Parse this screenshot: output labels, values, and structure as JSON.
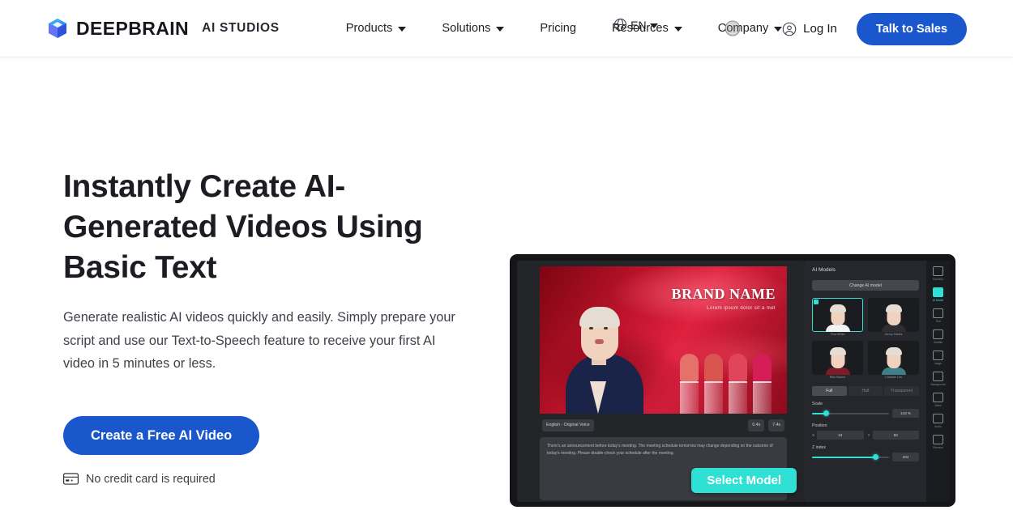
{
  "header": {
    "brand": {
      "name": "DEEPBRAIN",
      "sub": "AI STUDIOS",
      "logo_icon": "cube-logo-icon"
    },
    "nav": [
      {
        "label": "Products",
        "has_chevron": true
      },
      {
        "label": "Solutions",
        "has_chevron": true
      },
      {
        "label": "Pricing",
        "has_chevron": false
      },
      {
        "label": "Resources",
        "has_chevron": true
      },
      {
        "label": "Company",
        "has_chevron": true
      }
    ],
    "language": {
      "label": "EN",
      "icon": "globe-icon"
    },
    "login": {
      "label": "Log In",
      "icon": "user-circle-icon"
    },
    "cta": {
      "label": "Talk to Sales",
      "color": "#1a56cc"
    }
  },
  "hero": {
    "title": "Instantly Create AI-Generated Videos Using Basic Text",
    "subtitle": "Generate realistic AI videos quickly and easily. Simply prepare your script and use our Text-to-Speech feature to receive your first AI video in 5 minutes or less.",
    "cta": {
      "label": "Create a Free AI Video",
      "color": "#1a56cc"
    },
    "note": {
      "label": "No credit card is required",
      "icon": "credit-card-icon"
    }
  },
  "demo": {
    "stage": {
      "brand_title": "BRAND NAME",
      "brand_tagline": "Lorem ipsum dolor sit a met"
    },
    "toolbar": {
      "voice": "English - Original Voice",
      "duration": "0.4s",
      "total": "7.4s"
    },
    "script": "There's an announcement before today's meeting. The meeting schedule tomorrow may change depending on the outcome of today's meeting. Please double-check your schedule after the meeting.",
    "select_model_button": "Select Model",
    "inspector": {
      "title": "AI Models",
      "change_button": "Change AI model",
      "models": [
        {
          "name": "Tina White",
          "selected": true,
          "shirt": "#f3f3f3"
        },
        {
          "name": "Jenny Hanks",
          "selected": false,
          "shirt": "#2d2e33"
        },
        {
          "name": "Rita Adams",
          "selected": false,
          "shirt": "#7d1c26"
        },
        {
          "name": "Clarisse Lim",
          "selected": false,
          "shirt": "#3f7f8c"
        }
      ],
      "tabs": [
        {
          "label": "Full",
          "active": true
        },
        {
          "label": "Half",
          "active": false
        },
        {
          "label": "Transparent",
          "active": false
        }
      ],
      "controls": [
        {
          "label": "Scale",
          "value": "143 %",
          "percent": 18
        },
        {
          "label": "Position",
          "x": "24",
          "y": "60"
        },
        {
          "label": "Z index",
          "value": "404",
          "percent": 82
        }
      ]
    },
    "tools": [
      {
        "label": "Scenario",
        "icon": "scenario-icon",
        "active": false
      },
      {
        "label": "AI Model",
        "icon": "ai-model-icon",
        "active": true
      },
      {
        "label": "Text",
        "icon": "text-icon",
        "active": false
      },
      {
        "label": "Subtitle",
        "icon": "subtitle-icon",
        "active": false
      },
      {
        "label": "Image",
        "icon": "image-icon",
        "active": false
      },
      {
        "label": "Background",
        "icon": "background-icon",
        "active": false
      },
      {
        "label": "Video",
        "icon": "video-icon",
        "active": false
      },
      {
        "label": "Audio",
        "icon": "audio-icon",
        "active": false
      },
      {
        "label": "Element",
        "icon": "element-icon",
        "active": false
      }
    ]
  }
}
